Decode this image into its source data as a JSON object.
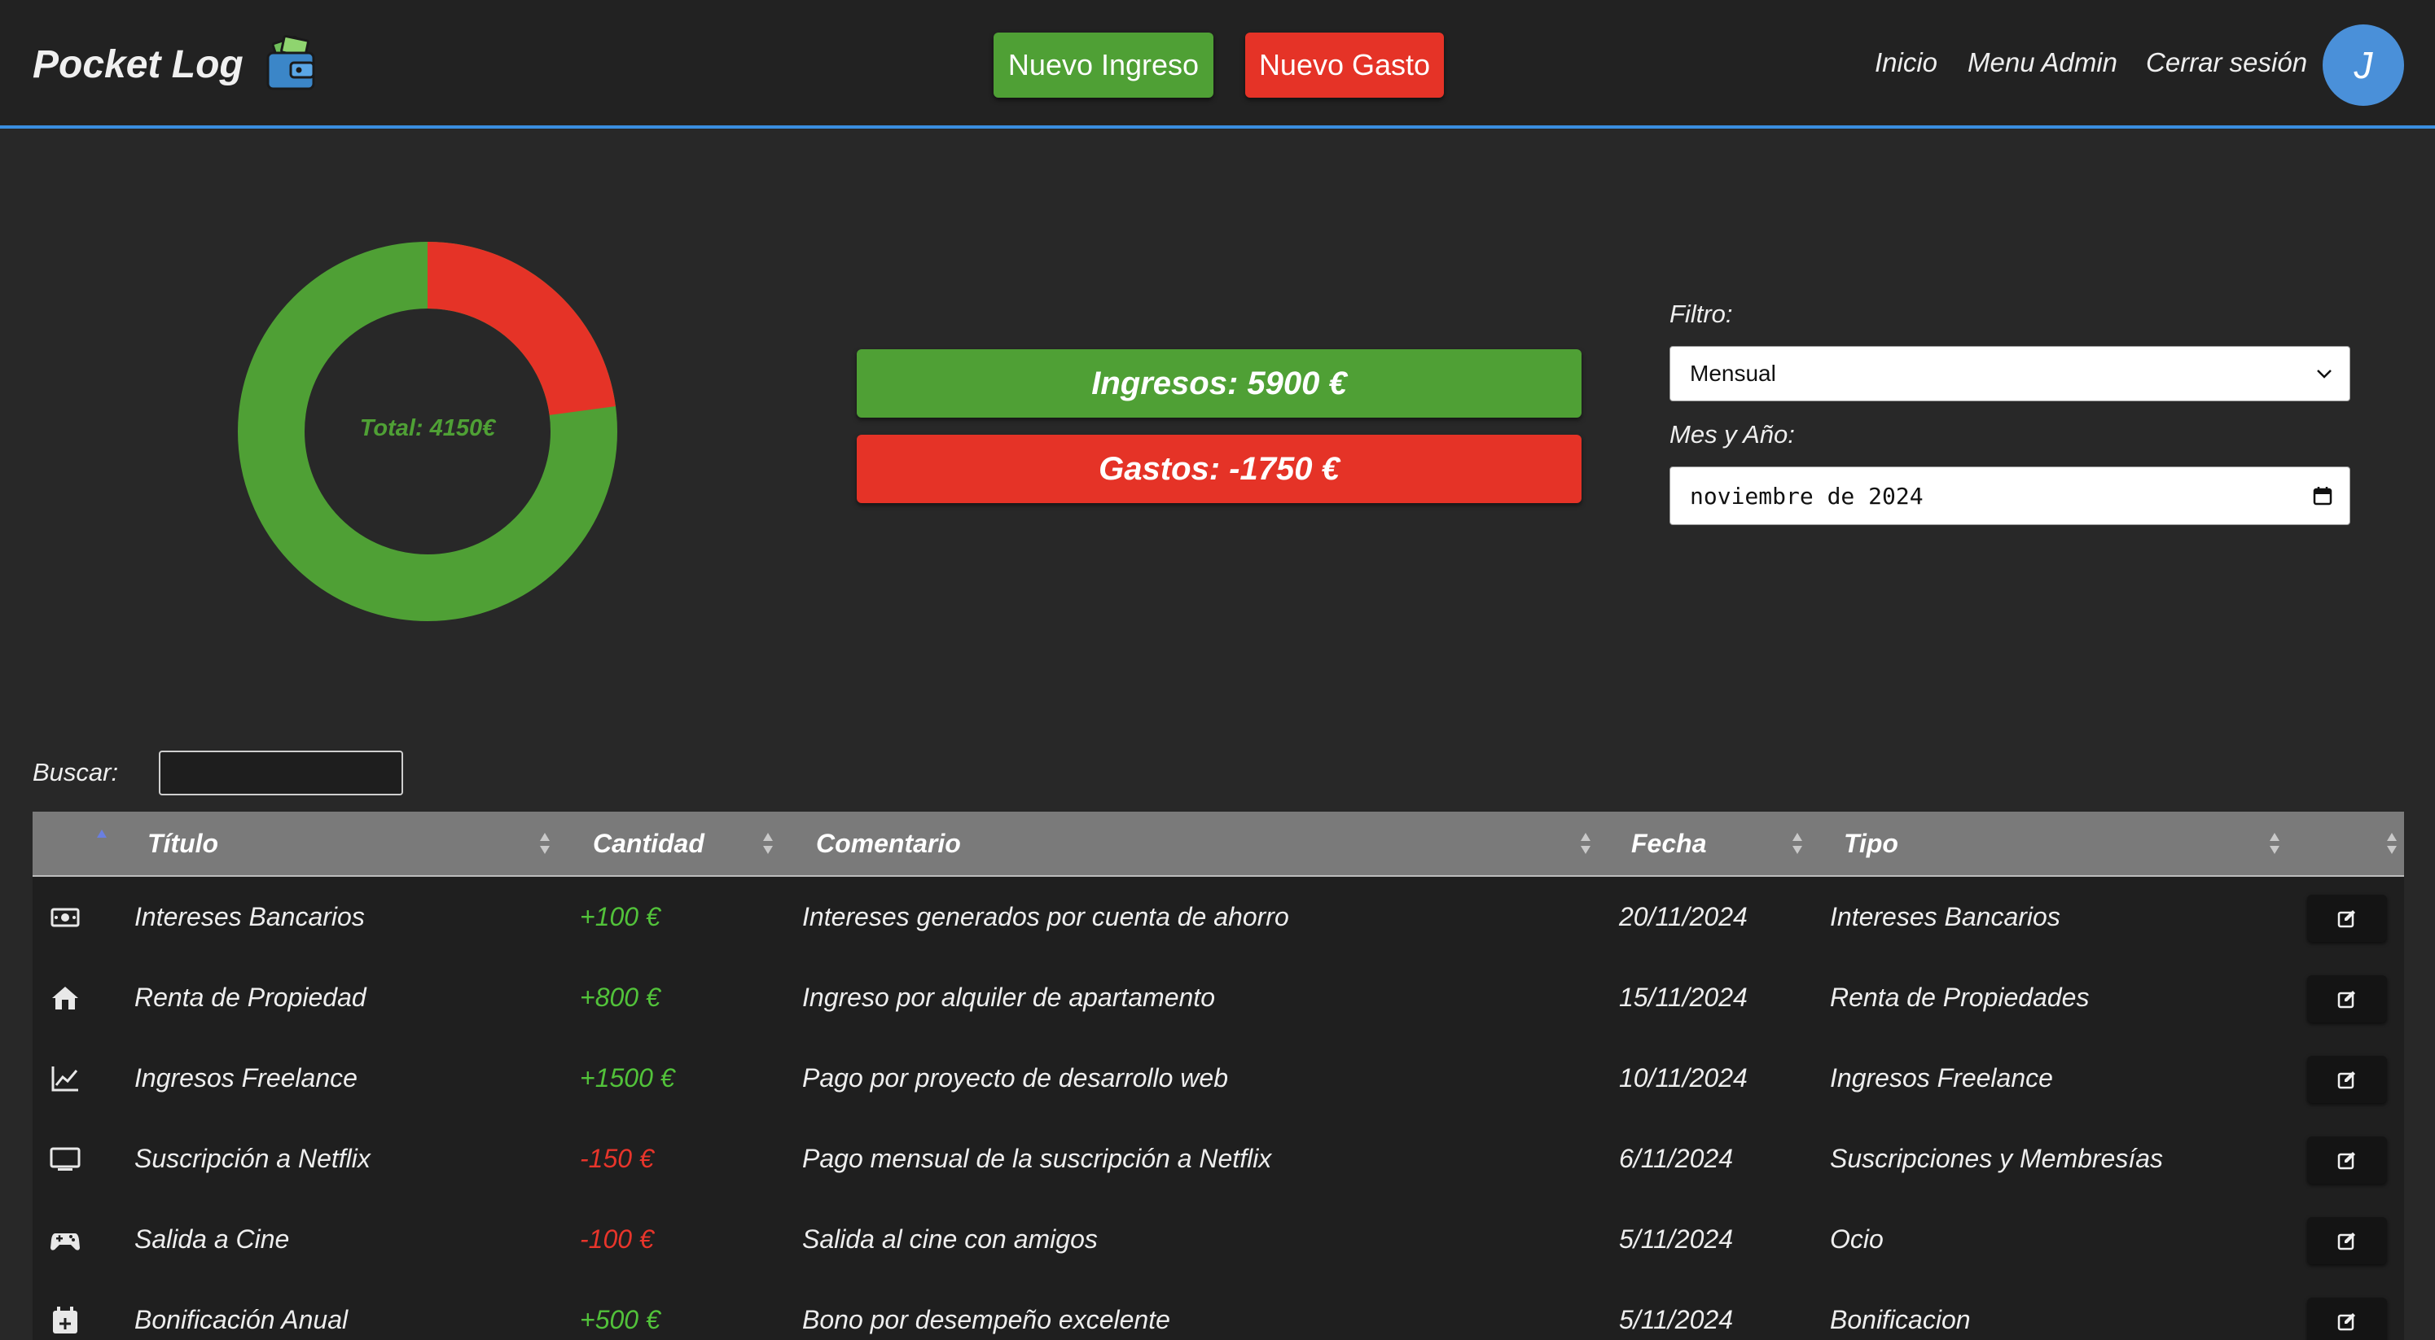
{
  "header": {
    "app_title": "Pocket Log",
    "new_income_label": "Nuevo Ingreso",
    "new_expense_label": "Nuevo Gasto",
    "nav": {
      "home": "Inicio",
      "admin": "Menu Admin",
      "logout": "Cerrar sesión"
    },
    "avatar_initial": "J"
  },
  "summary": {
    "total_label": "Total: 4150€",
    "income_label": "Ingresos: 5900 €",
    "expense_label": "Gastos: -1750 €",
    "chart": {
      "type": "donut",
      "values": {
        "income": 5900,
        "expense": 1750
      },
      "colors": {
        "income": "#4fa035",
        "expense": "#e53327"
      }
    }
  },
  "filters": {
    "filter_label": "Filtro:",
    "filter_value": "Mensual",
    "month_label": "Mes y Año:",
    "month_value": "noviembre de 2024"
  },
  "search": {
    "label": "Buscar:",
    "value": ""
  },
  "table": {
    "columns": {
      "title": "Título",
      "amount": "Cantidad",
      "comment": "Comentario",
      "date": "Fecha",
      "type": "Tipo"
    },
    "rows": [
      {
        "icon": "money-icon",
        "title": "Intereses Bancarios",
        "amount": "+100 €",
        "sign": "pos",
        "comment": "Intereses generados por cuenta de ahorro",
        "date": "20/11/2024",
        "type": "Intereses Bancarios"
      },
      {
        "icon": "house-icon",
        "title": "Renta de Propiedad",
        "amount": "+800 €",
        "sign": "pos",
        "comment": "Ingreso por alquiler de apartamento",
        "date": "15/11/2024",
        "type": "Renta de Propiedades"
      },
      {
        "icon": "chart-line-icon",
        "title": "Ingresos Freelance",
        "amount": "+1500 €",
        "sign": "pos",
        "comment": "Pago por proyecto de desarrollo web",
        "date": "10/11/2024",
        "type": "Ingresos Freelance"
      },
      {
        "icon": "tv-icon",
        "title": "Suscripción a Netflix",
        "amount": "-150 €",
        "sign": "neg",
        "comment": "Pago mensual de la suscripción a Netflix",
        "date": "6/11/2024",
        "type": "Suscripciones y Membresías"
      },
      {
        "icon": "gamepad-icon",
        "title": "Salida a Cine",
        "amount": "-100 €",
        "sign": "neg",
        "comment": "Salida al cine con amigos",
        "date": "5/11/2024",
        "type": "Ocio"
      },
      {
        "icon": "calendar-plus-icon",
        "title": "Bonificación Anual",
        "amount": "+500 €",
        "sign": "pos",
        "comment": "Bono por desempeño excelente",
        "date": "5/11/2024",
        "type": "Bonificacion"
      }
    ]
  }
}
